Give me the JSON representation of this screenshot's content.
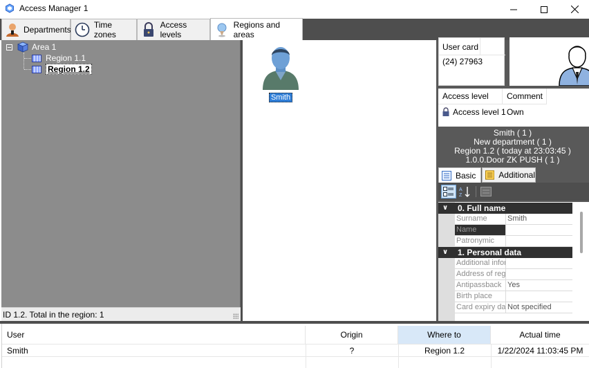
{
  "window": {
    "title": "Access Manager 1",
    "app_icon": "app-hex-icon"
  },
  "tabs": [
    {
      "label": "Departments",
      "icon": "person-icon"
    },
    {
      "label": "Time zones",
      "icon": "clock-icon"
    },
    {
      "label": "Access levels",
      "icon": "padlock-icon"
    },
    {
      "label": "Regions and areas",
      "icon": "location-pin-icon",
      "active": true
    }
  ],
  "tree": {
    "root": "Area 1",
    "children": [
      "Region 1.1",
      "Region 1.2"
    ],
    "selected": "Region 1.2"
  },
  "status_bar": "ID 1.2. Total in the region: 1",
  "region_users": [
    {
      "name": "Smith"
    }
  ],
  "user_card": {
    "label": "User card",
    "value": "(24) 27963"
  },
  "access_table": {
    "headers": [
      "Access level",
      "Comment"
    ],
    "rows": [
      {
        "level": "Access level 1",
        "comment": "Own"
      }
    ]
  },
  "info_lines": [
    "Smith ( 1 )",
    "New department ( 1 )",
    "Region 1.2 ( today at 23:03:45 )",
    "1.0.0.Door ZK PUSH ( 1 )"
  ],
  "subtabs": [
    "Basic",
    "Additional"
  ],
  "properties": {
    "categories": [
      {
        "title": "0. Full name",
        "items": [
          {
            "name": "Surname",
            "value": "Smith"
          },
          {
            "name": "Name",
            "value": ""
          },
          {
            "name": "Patronymic",
            "value": ""
          }
        ]
      },
      {
        "title": "1. Personal data",
        "items": [
          {
            "name": "Additional infor",
            "value": ""
          },
          {
            "name": "Address of reg",
            "value": ""
          },
          {
            "name": "Antipassback",
            "value": "Yes"
          },
          {
            "name": "Birth place",
            "value": ""
          },
          {
            "name": "Card expiry dat",
            "value": "Not specified"
          }
        ]
      }
    ]
  },
  "events_table": {
    "headers": [
      "User",
      "Origin",
      "Where to",
      "Actual time"
    ],
    "rows": [
      {
        "user": "Smith",
        "origin": "?",
        "where_to": "Region 1.2",
        "time": "1/22/2024 11:03:45 PM"
      }
    ]
  },
  "colors": {
    "dark_chrome": "#4e4e4e",
    "tree_background": "#8c8c8c",
    "selection_blue": "#2f7ed8",
    "sorted_header": "#d8e8f8"
  }
}
